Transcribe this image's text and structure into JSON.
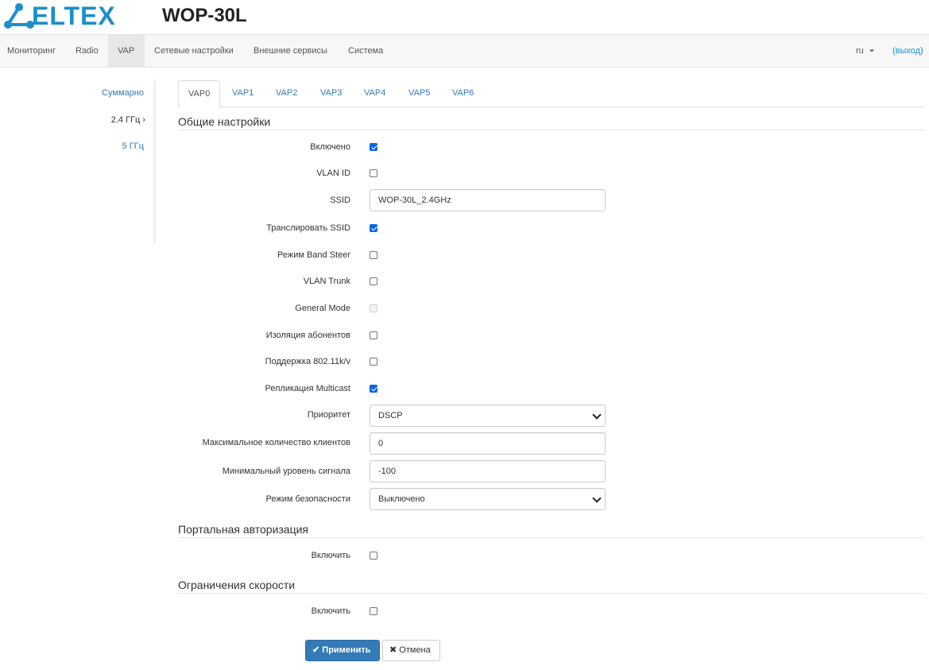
{
  "brand": {
    "logo_text": "ELTEX",
    "product": "WOP-30L",
    "color": "#1a8fc9"
  },
  "nav": {
    "items": [
      "Мониторинг",
      "Radio",
      "VAP",
      "Сетевые настройки",
      "Внешние сервисы",
      "Система"
    ],
    "active": "VAP",
    "lang": "ru",
    "logout": "(выход)"
  },
  "sidebar": {
    "items": [
      "Суммарно",
      "2.4 ГГц",
      "5 ГГц"
    ],
    "active": "2.4 ГГц",
    "active_marker": "›"
  },
  "tabs": {
    "items": [
      "VAP0",
      "VAP1",
      "VAP2",
      "VAP3",
      "VAP4",
      "VAP5",
      "VAP6"
    ],
    "active": "VAP0"
  },
  "general": {
    "title": "Общие настройки",
    "enabled": {
      "label": "Включено",
      "checked": true
    },
    "vlan_id": {
      "label": "VLAN ID",
      "checked": false
    },
    "ssid": {
      "label": "SSID",
      "value": "WOP-30L_2.4GHz"
    },
    "broadcast_ssid": {
      "label": "Транслировать SSID",
      "checked": true
    },
    "band_steer": {
      "label": "Режим Band Steer",
      "checked": false
    },
    "vlan_trunk": {
      "label": "VLAN Trunk",
      "checked": false
    },
    "general_mode": {
      "label": "General Mode",
      "checked": false,
      "disabled": true
    },
    "station_isolation": {
      "label": "Изоляция абонентов",
      "checked": false
    },
    "support_80211kv": {
      "label": "Поддержка 802.11k/v",
      "checked": false
    },
    "multicast_replication": {
      "label": "Репликация Multicast",
      "checked": true
    },
    "priority": {
      "label": "Приоритет",
      "value": "DSCP"
    },
    "max_clients": {
      "label": "Максимальное количество клиентов",
      "value": "0"
    },
    "min_signal": {
      "label": "Минимальный уровень сигнала",
      "value": "-100"
    },
    "security_mode": {
      "label": "Режим безопасности",
      "value": "Выключено"
    }
  },
  "portal": {
    "title": "Портальная авторизация",
    "enable": {
      "label": "Включить",
      "checked": false
    }
  },
  "rate_limit": {
    "title": "Ограничения скорости",
    "enable": {
      "label": "Включить",
      "checked": false
    }
  },
  "actions": {
    "apply": "Применить",
    "apply_icon": "✔",
    "cancel": "Отмена",
    "cancel_icon": "✖"
  },
  "colors": {
    "link": "#337ab7",
    "primary": "#337ab7",
    "checkbox": "#0a66e6"
  }
}
